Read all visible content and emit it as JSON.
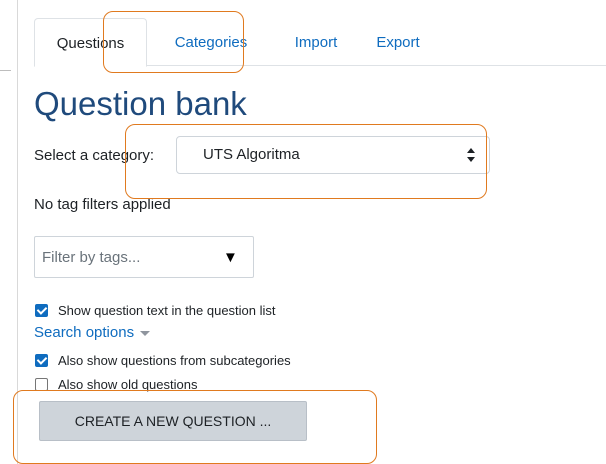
{
  "tabs": [
    {
      "label": "Questions",
      "active": true
    },
    {
      "label": "Categories",
      "active": false
    },
    {
      "label": "Import",
      "active": false
    },
    {
      "label": "Export",
      "active": false
    }
  ],
  "page_title": "Question bank",
  "category": {
    "label": "Select a category:",
    "selected": "UTS Algoritma"
  },
  "tags": {
    "status": "No tag filters applied",
    "placeholder": "Filter by tags..."
  },
  "options": {
    "show_question_text": "Show question text in the question list",
    "search_options_label": "Search options",
    "subcategories": "Also show questions from subcategories",
    "old_questions": "Also show old questions"
  },
  "create_button": "CREATE A NEW QUESTION ...",
  "colors": {
    "link": "#0f6cbf",
    "heading": "#1f4a7c",
    "highlight": "#e07a1f"
  }
}
